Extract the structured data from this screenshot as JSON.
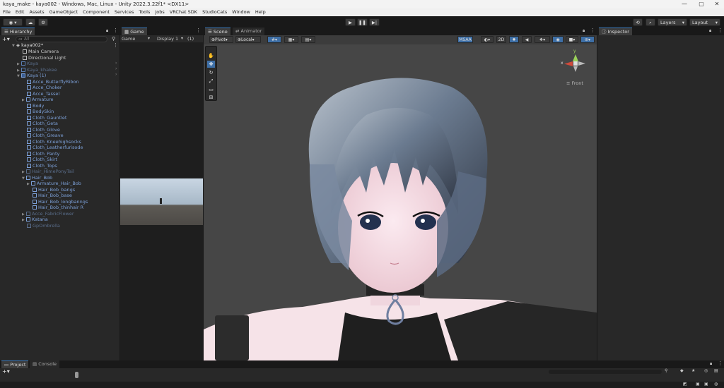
{
  "window": {
    "title": "kaya_make - kaya002 - Windows, Mac, Linux - Unity 2022.3.22f1* <DX11>",
    "controls": {
      "minimize": "—",
      "maximize": "▢",
      "close": "✕"
    }
  },
  "menu": [
    "File",
    "Edit",
    "Assets",
    "GameObject",
    "Component",
    "Services",
    "Tools",
    "Jobs",
    "VRChat SDK",
    "StudioCats",
    "Window",
    "Help"
  ],
  "toolbar": {
    "account_label": "⊚ ",
    "layers_label": "Layers",
    "layout_label": "Layout"
  },
  "hierarchy": {
    "tab_label": "Hierarchy",
    "search_placeholder": "All",
    "scene_name": "kaya002*",
    "items": [
      {
        "label": "Main Camera"
      },
      {
        "label": "Directional Light"
      },
      {
        "label": "Kaya"
      },
      {
        "label": "Kaya_khakee"
      },
      {
        "label": "Kaya (1)"
      },
      {
        "label": "Acce_ButterflyRibon"
      },
      {
        "label": "Acce_Choker"
      },
      {
        "label": "Acce_Tassel"
      },
      {
        "label": "Armature"
      },
      {
        "label": "Body"
      },
      {
        "label": "BodySkin"
      },
      {
        "label": "Cloth_Gauntlet"
      },
      {
        "label": "Cloth_Geta"
      },
      {
        "label": "Cloth_Glove"
      },
      {
        "label": "Cloth_Greave"
      },
      {
        "label": "Cloth_Kneehighsocks"
      },
      {
        "label": "Cloth_Leatherfurisode"
      },
      {
        "label": "Cloth_Panty"
      },
      {
        "label": "Cloth_Skirt"
      },
      {
        "label": "Cloth_Tops"
      },
      {
        "label": "Hair_HimePonyTail"
      },
      {
        "label": "Hair_Bob"
      },
      {
        "label": "Armature_Hair_Bob"
      },
      {
        "label": "Hair_Bob_bangs"
      },
      {
        "label": "Hair_Bob_base"
      },
      {
        "label": "Hair_Bob_longbanngs"
      },
      {
        "label": "Hair_Bob_thinhair R"
      },
      {
        "label": "Acce_FabricFlower"
      },
      {
        "label": "Katana"
      },
      {
        "label": "GpOmbrella"
      }
    ]
  },
  "game": {
    "tab_label": "Game",
    "mode": "Game",
    "display": "Display 1",
    "resolution": "(1)"
  },
  "scene": {
    "tab_label": "Scene",
    "animator_tab": "Animator",
    "pivot": "Pivot",
    "space": "Local",
    "msaa": "MSAA",
    "mode_2d": "2D",
    "gizmo_axes": {
      "x": "x",
      "y": "y"
    },
    "gizmo_view": "Front"
  },
  "inspector": {
    "tab_label": "Inspector"
  },
  "bottom": {
    "project_tab": "Project",
    "console_tab": "Console"
  },
  "colors": {
    "accent": "#3a79bb",
    "background": "#191919",
    "panel": "#282828",
    "scene_bg": "#464646"
  }
}
